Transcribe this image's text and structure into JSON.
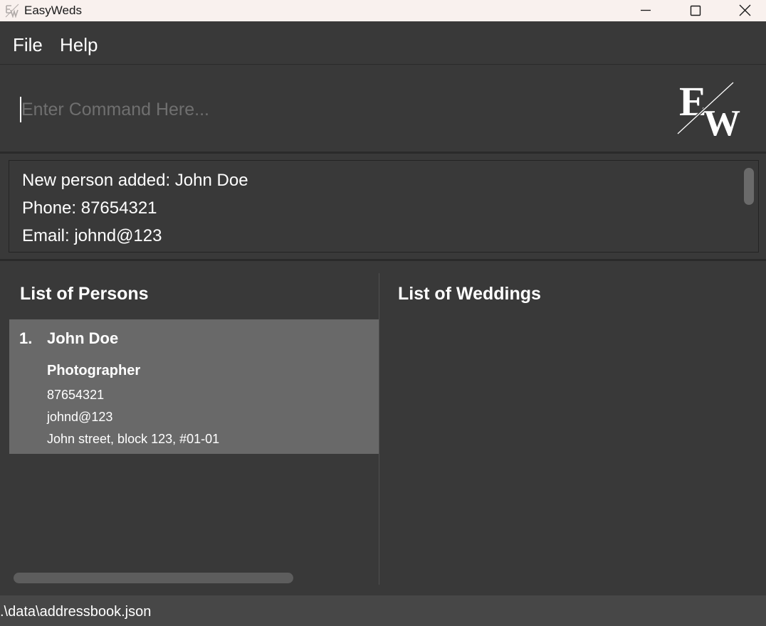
{
  "window": {
    "title": "EasyWeds",
    "icons": {
      "app": "easyweds-logo-icon",
      "minimize": "minimize-icon",
      "maximize": "maximize-icon",
      "close": "close-icon"
    }
  },
  "menu": {
    "items": [
      "File",
      "Help"
    ]
  },
  "command": {
    "value": "",
    "placeholder": "Enter Command Here..."
  },
  "logo": {
    "letters": "EW"
  },
  "result": {
    "lines": [
      "New person added: John Doe",
      "Phone: 87654321",
      "Email: johnd@123"
    ]
  },
  "persons_panel": {
    "title": "List of Persons",
    "persons": [
      {
        "index": "1.",
        "name": "John Doe",
        "role": "Photographer",
        "phone": "87654321",
        "email": "johnd@123",
        "address": "John street, block 123, #01-01"
      }
    ]
  },
  "weddings_panel": {
    "title": "List of Weddings"
  },
  "status": {
    "path": ".\\data\\addressbook.json"
  },
  "colors": {
    "background": "#393939",
    "titlebar": "#f9f1ee",
    "selected_card": "#696969",
    "statusbar": "#474747",
    "placeholder": "#6f6f6f"
  }
}
